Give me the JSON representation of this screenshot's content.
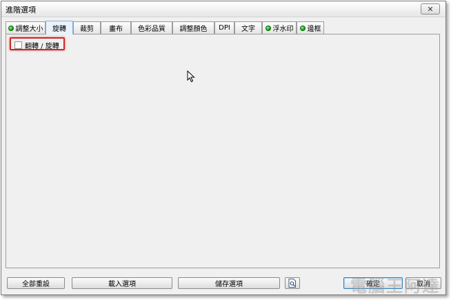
{
  "window": {
    "title": "進階選項"
  },
  "close_symbol": "✕",
  "tabs": [
    {
      "label": "調整大小",
      "icon": "green-dot-icon"
    },
    {
      "label": "旋轉",
      "active": true
    },
    {
      "label": "裁剪"
    },
    {
      "label": "畫布"
    },
    {
      "label": "色彩品質"
    },
    {
      "label": "調整顏色"
    },
    {
      "label": "DPI"
    },
    {
      "label": "文字"
    },
    {
      "label": "浮水印",
      "icon": "green-dot-icon"
    },
    {
      "label": "邊框",
      "icon": "green-dot-icon"
    }
  ],
  "panel": {
    "checkbox_label": "翻轉 / 旋轉",
    "checked": false,
    "highlight_color": "#d22424"
  },
  "buttons": {
    "reset_all": "全部重設",
    "load_options": "載入選項",
    "save_options": "儲存選項",
    "ok": "確定",
    "cancel": "取消"
  },
  "watermark": "電腦王阿達",
  "colors": {
    "accent_dot": "#12a812",
    "active_tab": "#e8f2fc"
  }
}
